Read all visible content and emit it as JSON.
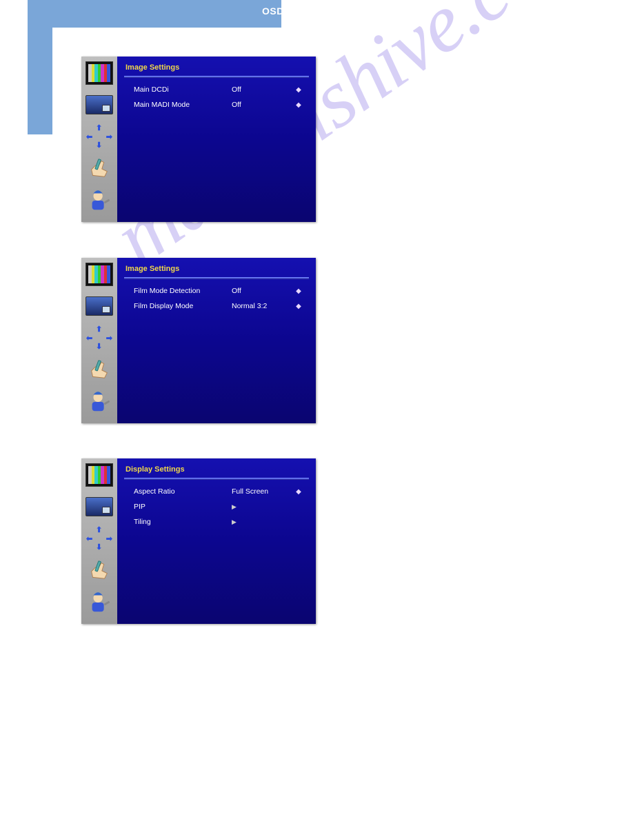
{
  "header": {
    "label": "OSD Menu Function"
  },
  "watermark": "manualshive.com",
  "panels": [
    {
      "title": "Image Settings",
      "rows": [
        {
          "label": "Main DCDi",
          "value": "Off",
          "type": "updown"
        },
        {
          "label": "Main MADI Mode",
          "value": "Off",
          "type": "updown"
        }
      ]
    },
    {
      "title": "Image Settings",
      "rows": [
        {
          "label": "Film Mode Detection",
          "value": "Off",
          "type": "updown"
        },
        {
          "label": "Film Display Mode",
          "value": "Normal 3:2",
          "type": "updown"
        }
      ]
    },
    {
      "title": "Display Settings",
      "rows": [
        {
          "label": "Aspect Ratio",
          "value": "Full Screen",
          "type": "updown"
        },
        {
          "label": "PIP",
          "value": "",
          "type": "submenu"
        },
        {
          "label": "Tiling",
          "value": "",
          "type": "submenu"
        }
      ]
    }
  ],
  "sidebar_icons": [
    {
      "name": "color-bars-icon"
    },
    {
      "name": "monitor-icon"
    },
    {
      "name": "arrows-icon"
    },
    {
      "name": "hand-icon"
    },
    {
      "name": "engineer-icon"
    }
  ]
}
